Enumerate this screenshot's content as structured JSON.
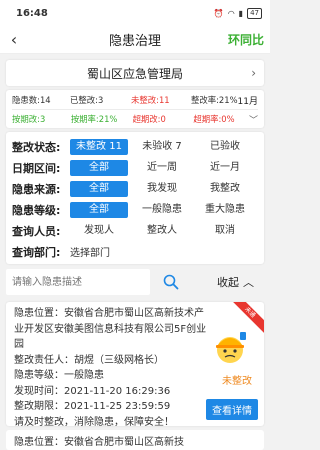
{
  "status_bar": {
    "time": "16:48",
    "battery": "47"
  },
  "nav": {
    "title": "隐患治理",
    "right_label": "环同比"
  },
  "department": {
    "name": "蜀山区应急管理局"
  },
  "stats": {
    "row1": {
      "total": "隐患数:14",
      "closed": "已整改:3",
      "unrectified": "未整改:11",
      "rate": "整改率:21%",
      "month": "11月"
    },
    "row2": {
      "on_time": "按期改:3",
      "on_time_rate": "按期率:21%",
      "overdue": "超期改:0",
      "overdue_rate": "超期率:0%"
    }
  },
  "filters": {
    "status": {
      "label": "整改状态:",
      "options": [
        "未整改 11",
        "未验收 7",
        "已验收"
      ]
    },
    "date": {
      "label": "日期区间:",
      "options": [
        "全部",
        "近一周",
        "近一月"
      ]
    },
    "source": {
      "label": "隐患来源:",
      "options": [
        "全部",
        "我发现",
        "我整改"
      ]
    },
    "level": {
      "label": "隐患等级:",
      "options": [
        "全部",
        "一般隐患",
        "重大隐患"
      ]
    },
    "person": {
      "label": "查询人员:",
      "options": [
        "发现人",
        "整改人",
        "取消"
      ]
    },
    "dept": {
      "label": "查询部门:",
      "value": "选择部门"
    }
  },
  "search": {
    "placeholder": "请输入隐患描述",
    "collapse_label": "收起"
  },
  "issue": {
    "corner": "未通",
    "location": "隐患位置：安徽省合肥市蜀山区高新技术产业开发区安徽美图信息科技有限公司5F创业园",
    "owner": "整改责任人：胡煜（三级网格长）",
    "level": "隐患等级：一般隐患",
    "found_time": "发现时间：2021-11-20 16:29:36",
    "deadline": "整改期限：2021-11-25 23:59:59",
    "note": "请及时整改，消除隐患，保障安全！",
    "status": "未整改",
    "detail_label": "查看详情"
  },
  "issue2": {
    "location": "隐患位置：安徽省合肥市蜀山区高新技"
  }
}
